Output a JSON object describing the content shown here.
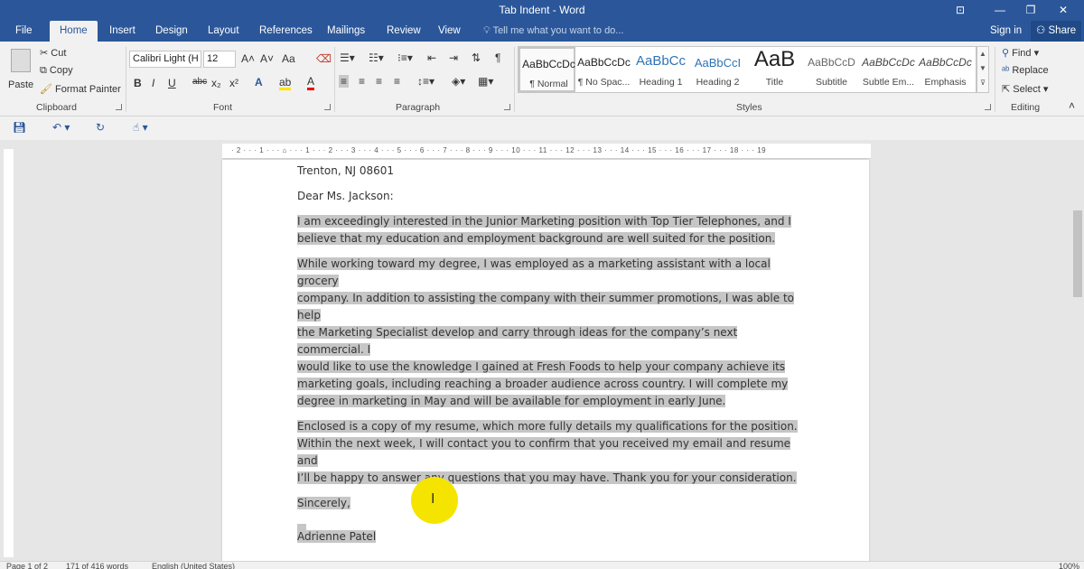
{
  "window": {
    "title": "Tab Indent - Word",
    "controls": {
      "ribbon_display": "⊡",
      "minimize": "—",
      "restore": "❐",
      "close": "✕"
    }
  },
  "tabs": {
    "file": "File",
    "home": "Home",
    "insert": "Insert",
    "design": "Design",
    "layout": "Layout",
    "references": "References",
    "mailings": "Mailings",
    "review": "Review",
    "view": "View"
  },
  "tell_me": {
    "text": "Tell me what you want to do...",
    "icon": "lightbulb-icon"
  },
  "account": {
    "sign_in": "Sign in",
    "share": "Share"
  },
  "ribbon": {
    "clipboard": {
      "label": "Clipboard",
      "paste": "Paste",
      "cut": "Cut",
      "copy": "Copy",
      "format_painter": "Format Painter"
    },
    "font": {
      "label": "Font",
      "font_name": "Calibri Light (H",
      "font_size": "12",
      "bold": "B",
      "italic": "I",
      "underline": "U",
      "strikethrough": "abc",
      "subscript": "x₂",
      "superscript": "x²",
      "grow": "A˄",
      "shrink": "A˅",
      "change_case": "Aa",
      "text_effects": "A",
      "highlight": "ab",
      "font_color": "A"
    },
    "paragraph": {
      "label": "Paragraph"
    },
    "styles": {
      "label": "Styles",
      "items": [
        {
          "preview": "AaBbCcDc",
          "name": "¶ Normal"
        },
        {
          "preview": "AaBbCcDc",
          "name": "¶ No Spac..."
        },
        {
          "preview": "AaBbCc",
          "name": "Heading 1"
        },
        {
          "preview": "AaBbCcI",
          "name": "Heading 2"
        },
        {
          "preview": "AaB",
          "name": "Title"
        },
        {
          "preview": "AaBbCcD",
          "name": "Subtitle"
        },
        {
          "preview": "AaBbCcDc",
          "name": "Subtle Em..."
        },
        {
          "preview": "AaBbCcDc",
          "name": "Emphasis"
        }
      ]
    },
    "editing": {
      "label": "Editing",
      "find": "Find",
      "replace": "Replace",
      "select": "Select"
    }
  },
  "document": {
    "address_line": "Trenton, NJ 08601",
    "salutation": "Dear Ms. Jackson:",
    "paragraphs": [
      [
        "I am exceedingly interested in the Junior Marketing position with Top Tier Telephones, and I",
        "believe that my education and employment background are well suited for the position."
      ],
      [
        "While working toward my degree, I was employed as a marketing assistant with a local grocery",
        "company. In addition to assisting the company with their summer promotions, I was able to help",
        "the Marketing Specialist develop and carry through ideas for the company’s next commercial. I",
        "would like to use the knowledge I gained at Fresh Foods to help your company achieve its",
        "marketing goals, including reaching a broader audience across country. I will complete my",
        "degree in marketing in May and will be available for employment in early June."
      ],
      [
        "Enclosed is a copy of my resume, which more fully details my qualifications for the position.",
        "Within the next week, I will contact you to confirm that you received my email and resume and",
        "I’ll be happy to answer any questions that you may have. Thank you for your consideration."
      ]
    ],
    "closing": "Sincerely,",
    "signature": "Adrienne Patel"
  },
  "ruler": {
    "horizontal": "· 2 · · · 1 · · · ⌂ · · · 1 · · · 2 · · · 3 · · · 4 · · · 5 · · · 6 · · · 7 · · · 8 · · · 9 · · · 10 · · · 11 · · · 12 · · · 13 · · · 14 · · · 15 · · · 16 · · · 17 · · · 18 · · · 19"
  },
  "status": {
    "page": "Page 1 of 2",
    "words": "171 of 416 words",
    "language": "English (United States)",
    "zoom": "100%"
  }
}
